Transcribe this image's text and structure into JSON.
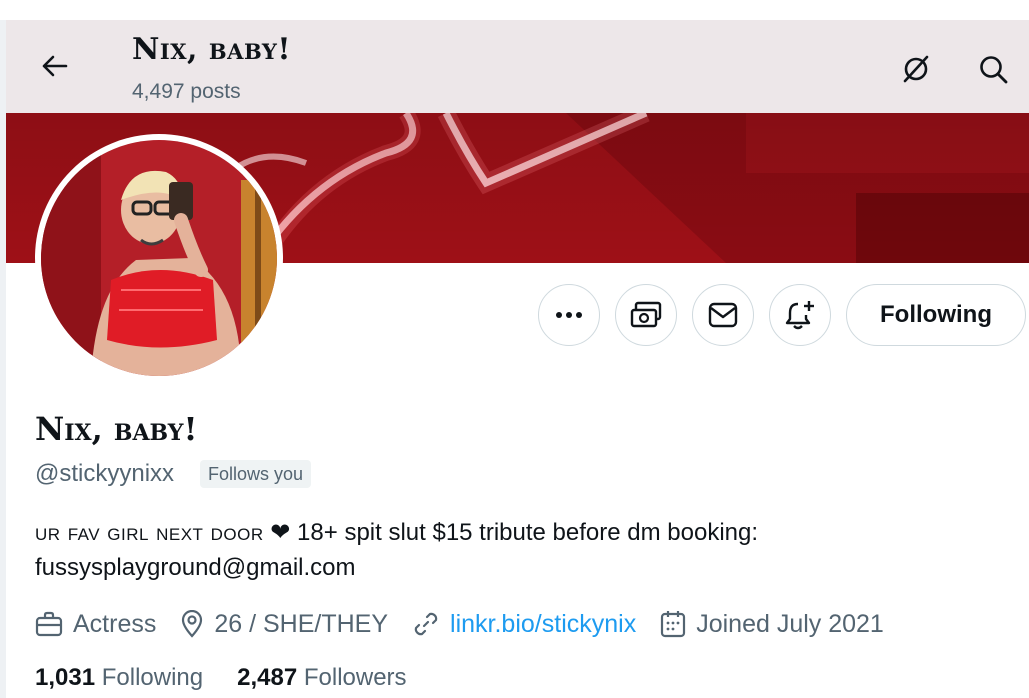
{
  "header": {
    "name": "Nix, baby!",
    "post_count": "4,497 posts",
    "back_icon": "arrow-left-icon",
    "grok_icon": "grok-icon",
    "search_icon": "search-icon"
  },
  "profile": {
    "display_name": "Nix, baby!",
    "handle": "@stickyynixx",
    "follows_you": "Follows you",
    "bio": {
      "part1": "ur fav girl next door",
      "heart": "❤",
      "part2": " 18+   spit slut   $15 tribute before dm   booking: fussysplayground@gmail.com"
    },
    "profession": "Actress",
    "location": "26 /  SHE/THEY",
    "website": "linkr.bio/stickynix",
    "joined": "Joined July 2021",
    "following_count": "1,031",
    "following_label": "Following",
    "followers_count": "2,487",
    "followers_label": "Followers"
  },
  "actions": {
    "more_icon": "more-icon",
    "tip_icon": "tip-icon",
    "message_icon": "message-icon",
    "notify_icon": "notify-bell-icon",
    "following_label": "Following"
  },
  "colors": {
    "link": "#1d9bf0",
    "secondary_text": "#536471",
    "banner_red": "#b2141c"
  }
}
